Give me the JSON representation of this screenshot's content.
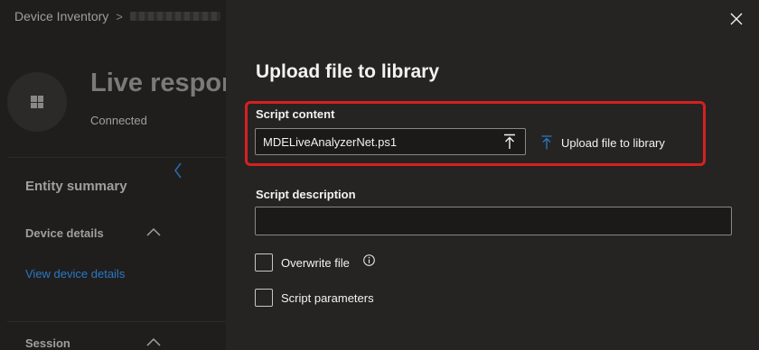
{
  "breadcrumb": {
    "root": "Device Inventory",
    "separator": ">"
  },
  "device": {
    "title": "Live respon",
    "status": "Connected",
    "icon": "windows-logo"
  },
  "sidebar": {
    "entity_summary": "Entity summary",
    "device_details": "Device details",
    "view_device_details": "View device details",
    "session": "Session"
  },
  "panel": {
    "title": "Upload file to library",
    "script_content_label": "Script content",
    "file_name": "MDELiveAnalyzerNet.ps1",
    "upload_link": "Upload file to library",
    "script_description_label": "Script description",
    "script_description_value": "",
    "overwrite_file_label": "Overwrite file",
    "script_parameters_label": "Script parameters"
  },
  "colors": {
    "panel_bg": "#252423",
    "page_bg": "#1f1e1d",
    "accent": "#2b78c4",
    "highlight_border": "#d62020",
    "text": "#f3f2f1"
  },
  "icons": {
    "close": "close-icon",
    "upload": "upload-icon",
    "info": "info-icon",
    "chevron_up": "chevron-up-icon",
    "chevron_left": "chevron-left-icon"
  }
}
